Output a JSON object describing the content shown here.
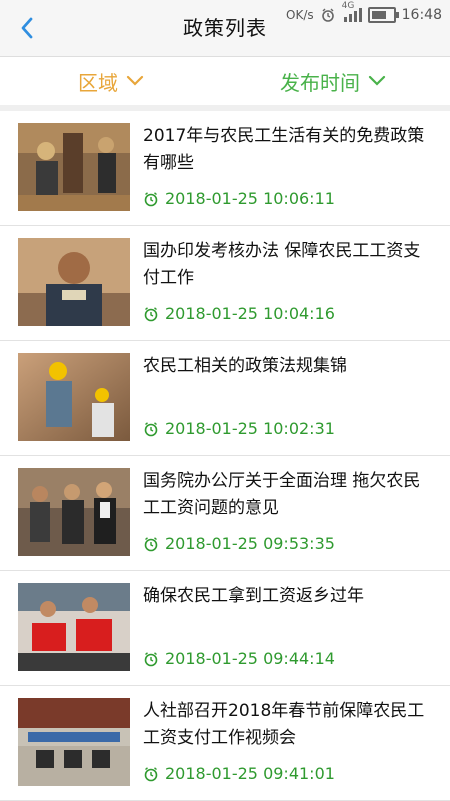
{
  "header": {
    "title": "政策列表",
    "back_icon": "chevron-left-icon",
    "status": {
      "network": "OK/s",
      "signal_label": "4G",
      "time": "16:48"
    }
  },
  "filters": [
    {
      "label": "区域",
      "color": "#e8a63a",
      "icon": "chevron-down-icon"
    },
    {
      "label": "发布时间",
      "color": "#49b24a",
      "icon": "chevron-down-icon"
    }
  ],
  "items": [
    {
      "title": "2017年与农民工生活有关的免费政策有哪些",
      "time": "2018-01-25 10:06:11"
    },
    {
      "title": "国办印发考核办法 保障农民工工资支付工作",
      "time": "2018-01-25 10:04:16"
    },
    {
      "title": "农民工相关的政策法规集锦",
      "time": "2018-01-25 10:02:31"
    },
    {
      "title": "国务院办公厅关于全面治理 拖欠农民工工资问题的意见",
      "time": "2018-01-25 09:53:35"
    },
    {
      "title": "确保农民工拿到工资返乡过年",
      "time": "2018-01-25 09:44:14"
    },
    {
      "title": "人社部召开2018年春节前保障农民工工资支付工作视频会",
      "time": "2018-01-25 09:41:01"
    }
  ],
  "colors": {
    "accent_orange": "#e8a63a",
    "accent_green": "#49b24a",
    "time_green": "#2f9a2f",
    "back_blue": "#2f8ee0"
  }
}
